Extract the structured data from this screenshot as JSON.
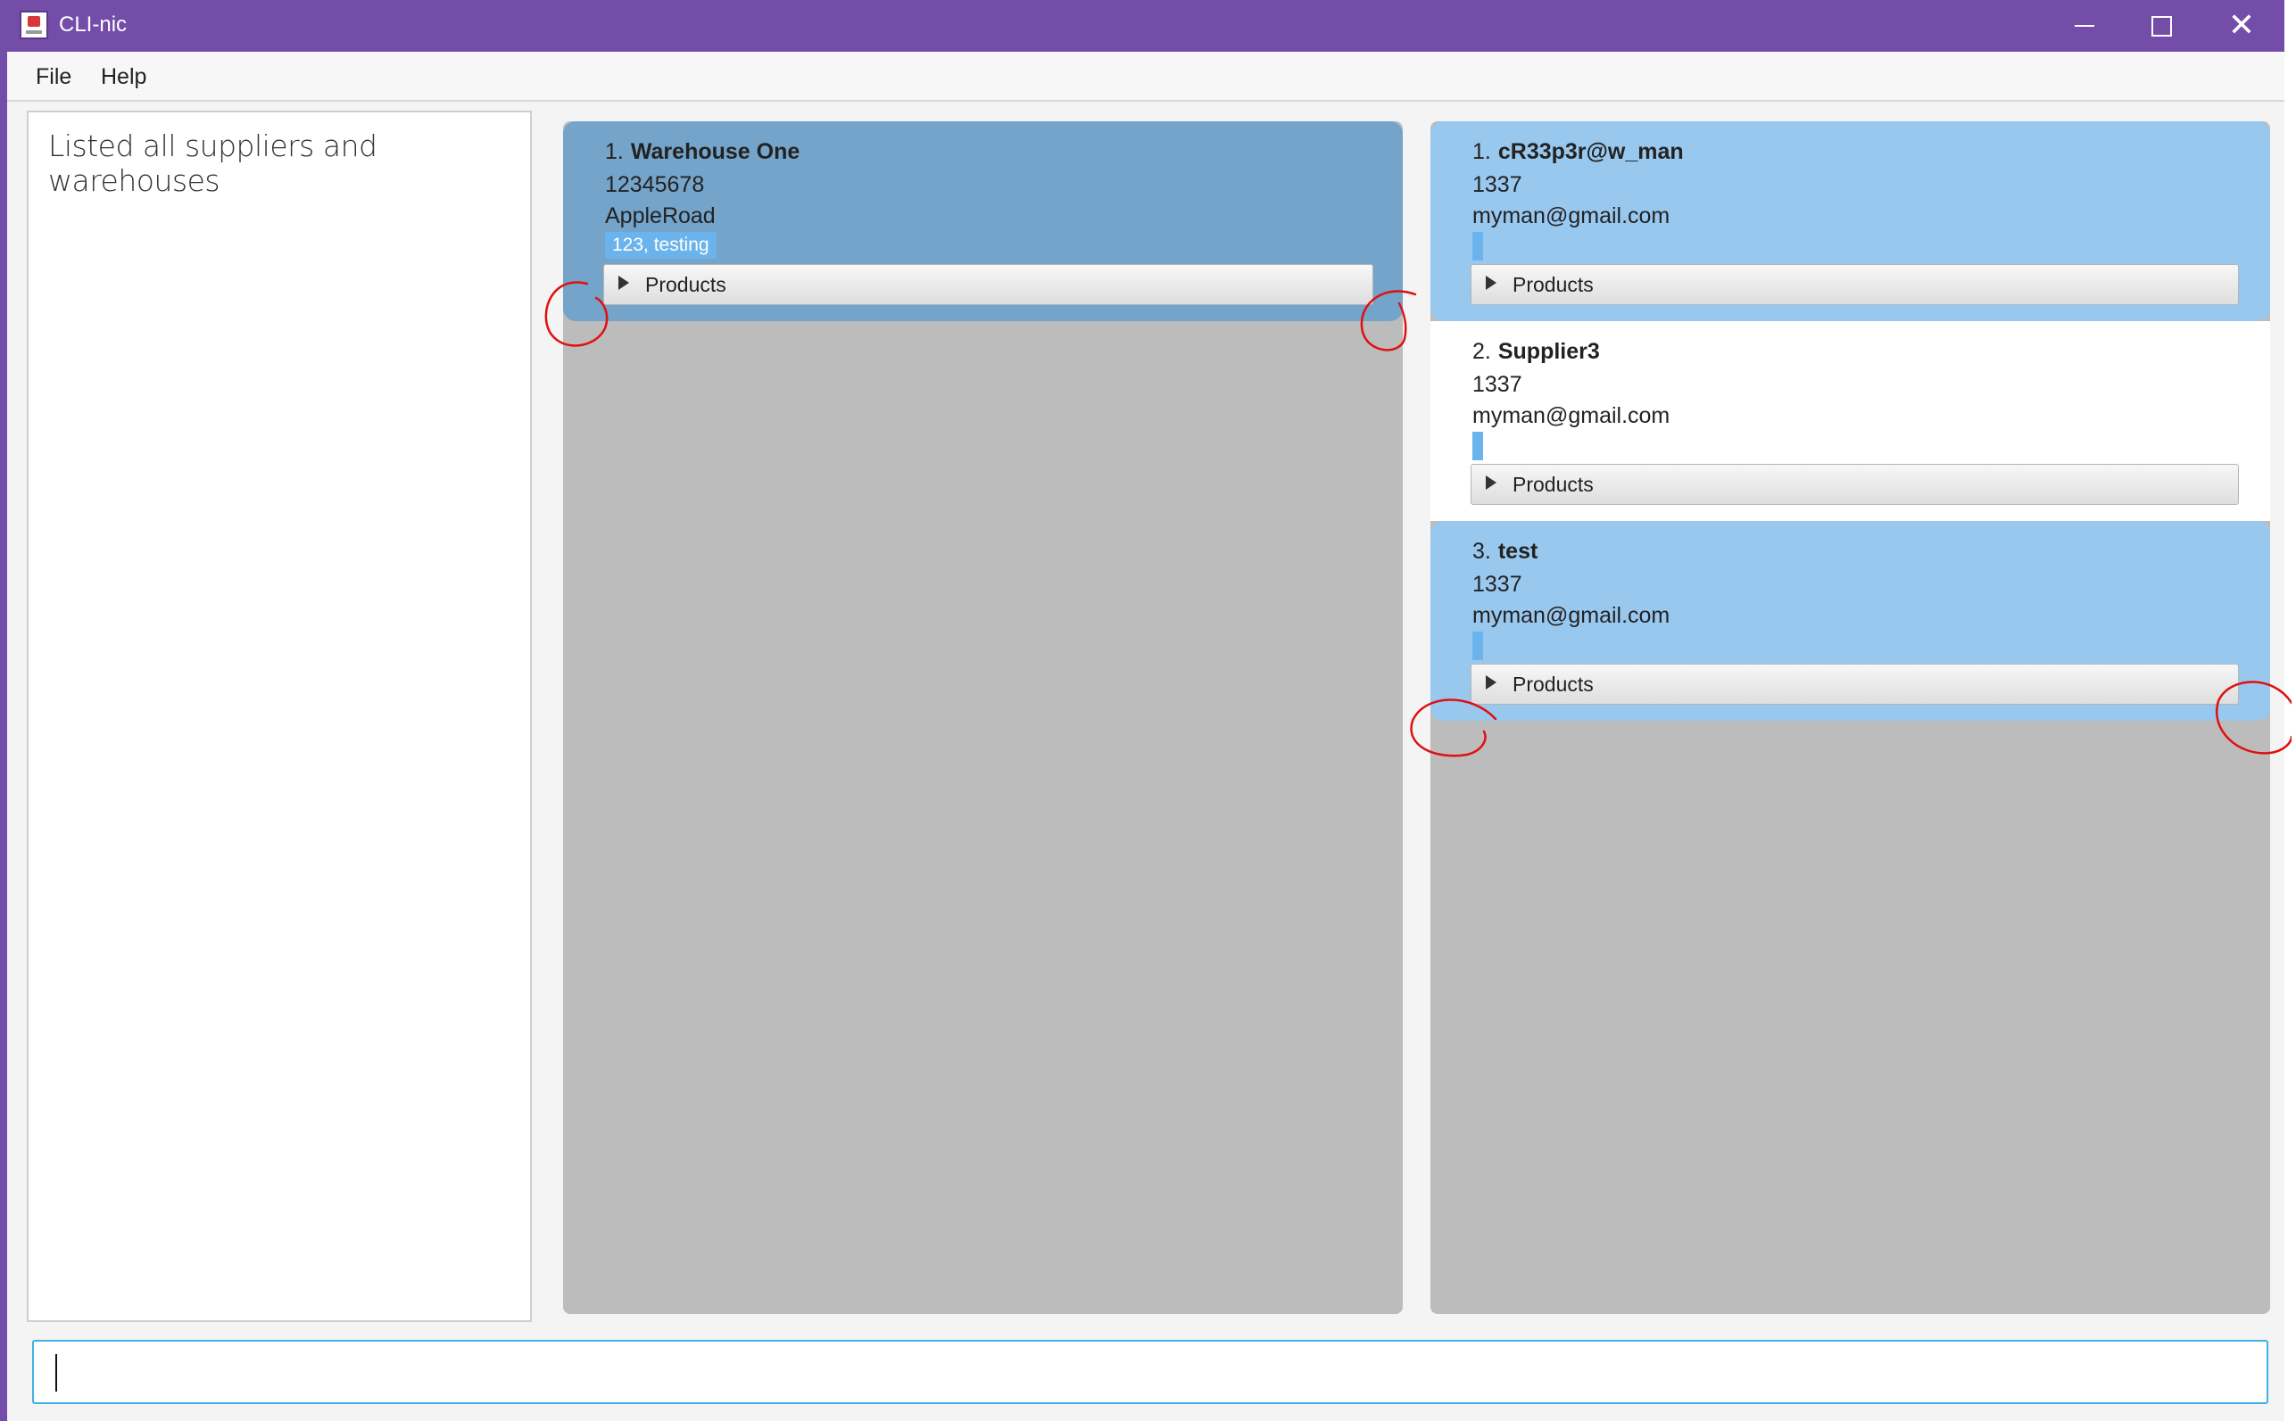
{
  "window": {
    "title": "CLI-nic"
  },
  "menu": {
    "file": "File",
    "help": "Help"
  },
  "result": {
    "text": "Listed all suppliers and warehouses"
  },
  "warehouses": [
    {
      "index": "1.",
      "name": "Warehouse One",
      "phone": "12345678",
      "address": "AppleRoad",
      "remark": "123, testing",
      "products_label": "Products"
    }
  ],
  "suppliers": [
    {
      "index": "1.",
      "name": "cR33p3r@w_man",
      "phone": "1337",
      "email": "myman@gmail.com",
      "products_label": "Products"
    },
    {
      "index": "2.",
      "name": "Supplier3",
      "phone": "1337",
      "email": "myman@gmail.com",
      "products_label": "Products"
    },
    {
      "index": "3.",
      "name": "test",
      "phone": "1337",
      "email": "myman@gmail.com",
      "products_label": "Products"
    }
  ],
  "command": {
    "value": ""
  },
  "colors": {
    "titlebar": "#744da9",
    "selected_warehouse": "#74a4c9",
    "selected_supplier": "#99c8ef",
    "tag": "#6bb3ec",
    "annotation": "#e01010"
  }
}
